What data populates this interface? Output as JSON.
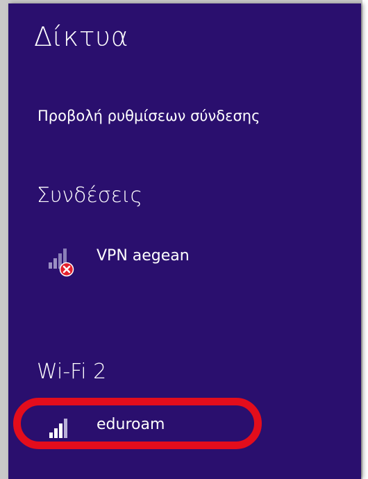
{
  "panel": {
    "title": "Δίκτυα",
    "settings_link": "Προβολή ρυθμίσεων σύνδεσης",
    "background_color": "#2a0f6e"
  },
  "connections": {
    "header": "Συνδέσεις",
    "items": [
      {
        "name": "VPN aegean",
        "icon": "signal-bars-icon",
        "status": "error",
        "status_icon": "disconnected-x-icon"
      }
    ]
  },
  "wifi": {
    "header": "Wi-Fi 2",
    "items": [
      {
        "name": "eduroam",
        "icon": "signal-bars-icon",
        "signal_bars": 4,
        "highlighted": true
      }
    ]
  },
  "highlight": {
    "color": "#e30d1c",
    "shape": "rounded-rectangle",
    "target": "eduroam"
  }
}
